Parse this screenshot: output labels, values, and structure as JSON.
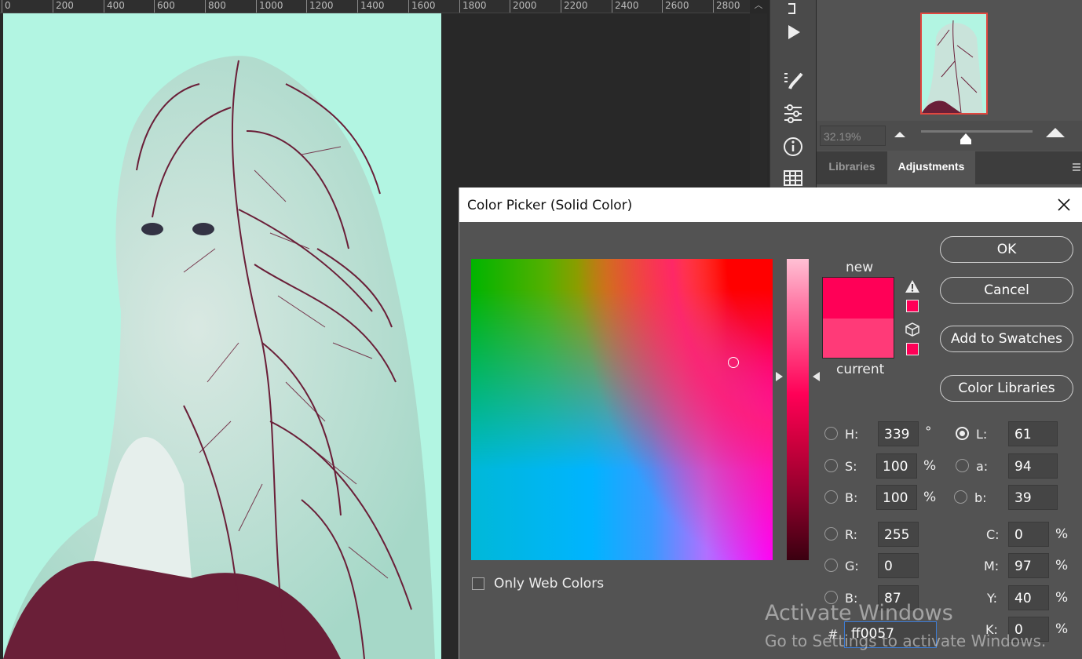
{
  "ruler": {
    "ticks": [
      "0",
      "200",
      "400",
      "600",
      "800",
      "1000",
      "1200",
      "1400",
      "1600",
      "1800",
      "2000",
      "2200",
      "2400",
      "2600",
      "2800"
    ]
  },
  "navigator": {
    "zoom": "32.19%"
  },
  "panel_tabs": {
    "libraries": "Libraries",
    "adjustments": "Adjustments"
  },
  "dialog": {
    "title": "Color Picker (Solid Color)",
    "new_label": "new",
    "current_label": "current",
    "new_color": "#ff0057",
    "current_color": "#ff3a78",
    "buttons": {
      "ok": "OK",
      "cancel": "Cancel",
      "add_to_swatches": "Add to Swatches",
      "color_libraries": "Color Libraries"
    },
    "only_web_colors": "Only Web Colors",
    "hsb": {
      "h_label": "H:",
      "h_value": "339",
      "h_unit": "°",
      "s_label": "S:",
      "s_value": "100",
      "s_unit": "%",
      "b_label": "B:",
      "b_value": "100",
      "b_unit": "%"
    },
    "rgb": {
      "r_label": "R:",
      "r_value": "255",
      "g_label": "G:",
      "g_value": "0",
      "b_label": "B:",
      "b_value": "87"
    },
    "lab": {
      "l_label": "L:",
      "l_value": "61",
      "a_label": "a:",
      "a_value": "94",
      "b_label": "b:",
      "b_value": "39"
    },
    "cmyk": {
      "c_label": "C:",
      "c_value": "0",
      "c_unit": "%",
      "m_label": "M:",
      "m_value": "97",
      "m_unit": "%",
      "y_label": "Y:",
      "y_value": "40",
      "y_unit": "%",
      "k_label": "K:",
      "k_value": "0",
      "k_unit": "%"
    },
    "hex_label": "#",
    "hex_value": "ff0057"
  },
  "watermark": {
    "line1": "Activate Windows",
    "line2": "Go to Settings to activate Windows."
  }
}
